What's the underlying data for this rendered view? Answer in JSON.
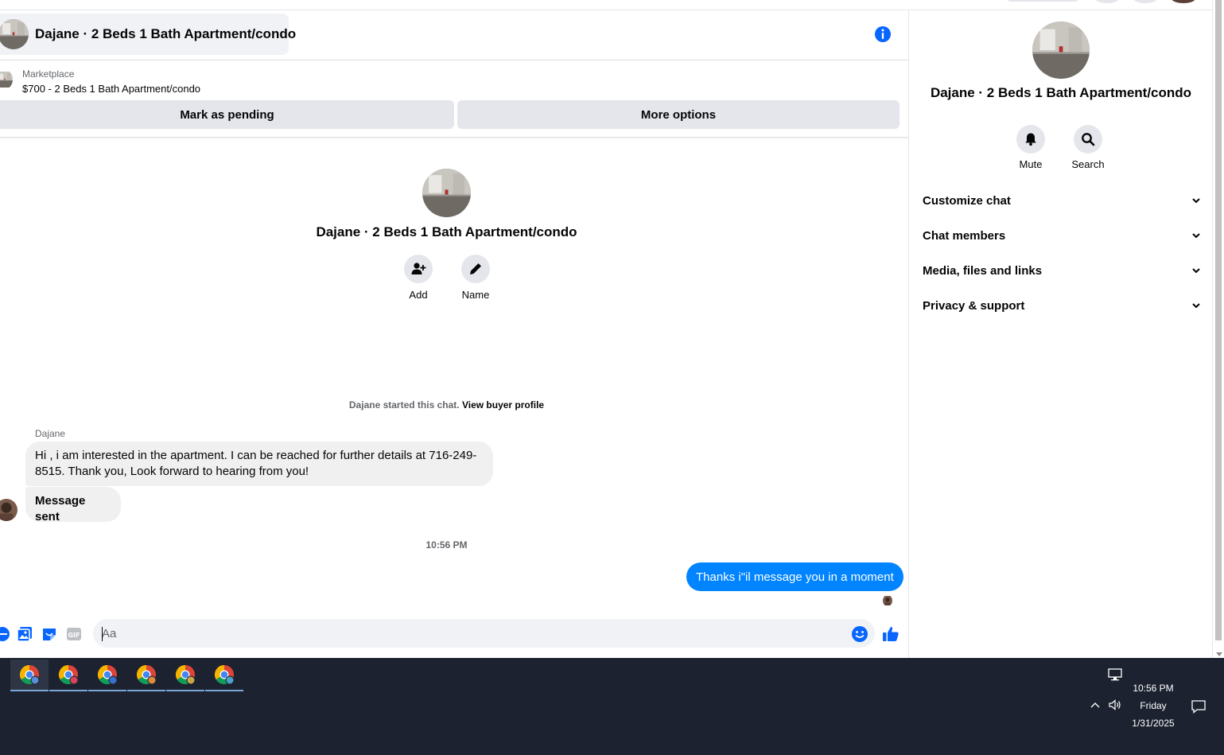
{
  "chat": {
    "title": "Dajane · 2 Beds 1 Bath Apartment/condo",
    "listing": {
      "label": "Marketplace",
      "title": "$700 - 2 Beds 1 Bath Apartment/condo",
      "pending_button": "Mark as pending",
      "more_button": "More options"
    },
    "intro": {
      "title": "Dajane · 2 Beds 1 Bath Apartment/condo",
      "add_label": "Add",
      "name_label": "Name"
    },
    "started": {
      "text": "Dajane started this chat.",
      "link": "View buyer profile"
    },
    "messages": {
      "sender": "Dajane",
      "incoming_1": "Hi , i am interested in the apartment. I can be reached for further details at 716-249-8515. Thank you, Look forward to hearing from you!",
      "incoming_2": "Message sent",
      "timestamp": "10:56 PM",
      "outgoing_1": "Thanks i\"il message you in a moment"
    },
    "composer": {
      "placeholder": "Aa"
    }
  },
  "details": {
    "title": "Dajane · 2 Beds 1 Bath Apartment/condo",
    "mute_label": "Mute",
    "search_label": "Search",
    "sections": [
      "Customize chat",
      "Chat members",
      "Media, files and links",
      "Privacy & support"
    ]
  },
  "taskbar": {
    "time": "10:56 PM",
    "day": "Friday",
    "date": "1/31/2025",
    "apps": [
      "chrome-icon",
      "chrome-icon",
      "chrome-icon",
      "chrome-icon",
      "chrome-icon",
      "chrome-icon"
    ]
  },
  "colors": {
    "messenger_blue": "#0084ff",
    "bubble_gray": "#f0f0f0",
    "button_gray": "#e4e6eb",
    "taskbar_bg": "#1c2230"
  }
}
